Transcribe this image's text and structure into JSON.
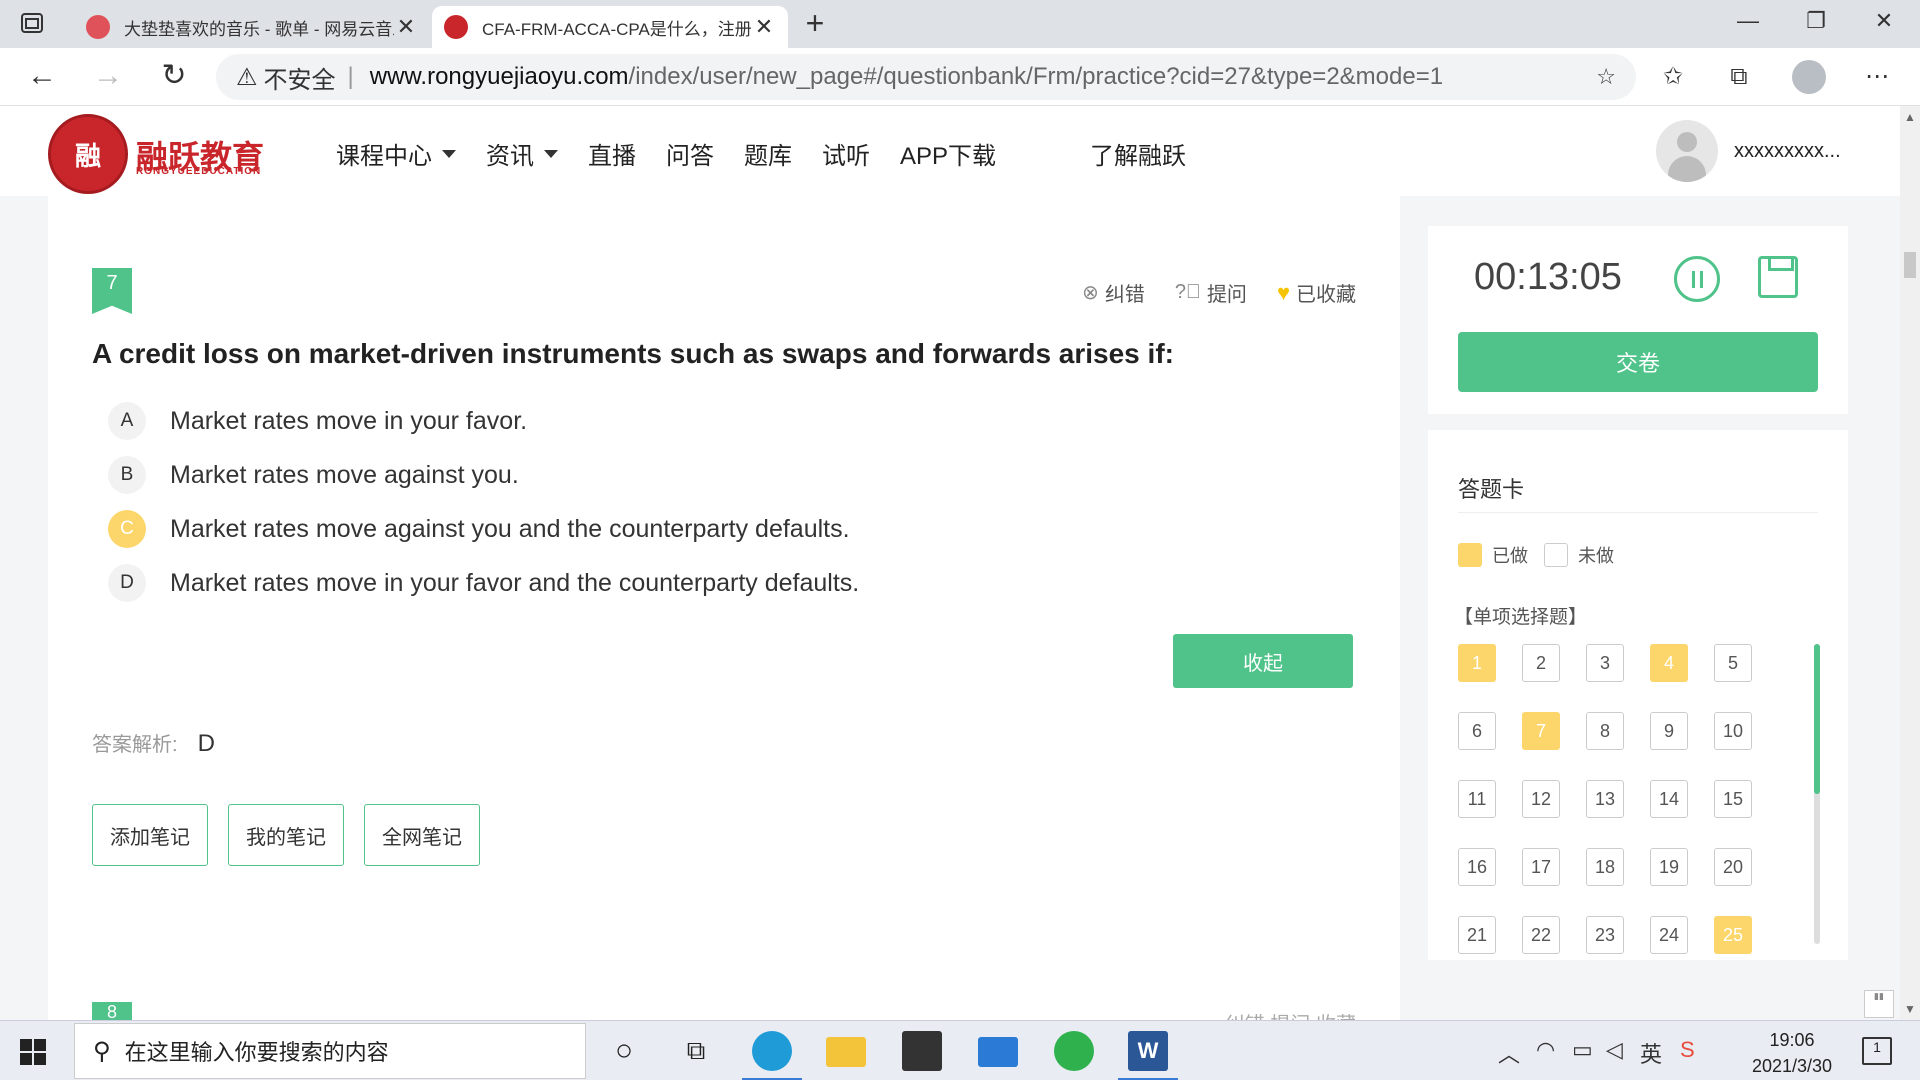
{
  "browser": {
    "tabs": [
      {
        "label": "大垫垫喜欢的音乐 - 歌单 - 网易云音乐",
        "active": false,
        "favicon_color": "#e0525a"
      },
      {
        "label": "CFA-FRM-ACCA-CPA是什么，注册金融分析师",
        "active": true,
        "favicon_color": "#c9262c"
      }
    ],
    "new_tab": "+",
    "window_controls": {
      "minimize": "—",
      "restore": "❐",
      "close": "✕"
    },
    "address": {
      "insecure_label": "不安全",
      "host": "www.rongyuejiaoyu.com",
      "path": "/index/user/new_page#/questionbank/Frm/practice?cid=27&type=2&mode=1"
    },
    "toolbar_icons": [
      "favorites-icon",
      "collections-icon",
      "profile-icon",
      "more-icon"
    ]
  },
  "site": {
    "logo_text": "融跃教育",
    "logo_subtext": "RONGYUEEDUCATION",
    "logo_mark": "融",
    "nav": [
      {
        "label": "课程中心",
        "dropdown": true
      },
      {
        "label": "资讯",
        "dropdown": true
      },
      {
        "label": "直播",
        "dropdown": false
      },
      {
        "label": "问答",
        "dropdown": false
      },
      {
        "label": "题库",
        "dropdown": false
      },
      {
        "label": "试听",
        "dropdown": false
      },
      {
        "label": "APP下载",
        "dropdown": false
      }
    ],
    "about": "了解融跃",
    "user_name": "xxxxxxxxx..."
  },
  "question": {
    "number": "7",
    "actions": {
      "report": "纠错",
      "ask": "提问",
      "favorite": "已收藏"
    },
    "text": "A credit loss on market-driven instruments such as swaps and forwards arises if:",
    "options": [
      {
        "letter": "A",
        "text": "Market rates move in your favor.",
        "selected": false
      },
      {
        "letter": "B",
        "text": "Market rates move against you.",
        "selected": false
      },
      {
        "letter": "C",
        "text": "Market rates move against you and the counterparty defaults.",
        "selected": true
      },
      {
        "letter": "D",
        "text": "Market rates move in your favor and the counterparty defaults.",
        "selected": false
      }
    ],
    "collapse_label": "收起",
    "analysis_label": "答案解析:",
    "answer": "D",
    "note_buttons": {
      "add": "添加笔记",
      "mine": "我的笔记",
      "all": "全网笔记"
    }
  },
  "next_question": {
    "number": "8",
    "actions": "纠错   提问   收藏"
  },
  "panel": {
    "timer": "00:13:05",
    "submit_label": "交卷",
    "card_title": "答题卡",
    "legend": {
      "done": "已做",
      "todo": "未做"
    },
    "section": "【单项选择题】",
    "cells": [
      {
        "n": "1",
        "done": true
      },
      {
        "n": "2",
        "done": false
      },
      {
        "n": "3",
        "done": false
      },
      {
        "n": "4",
        "done": true
      },
      {
        "n": "5",
        "done": false
      },
      {
        "n": "6",
        "done": false
      },
      {
        "n": "7",
        "done": true
      },
      {
        "n": "8",
        "done": false
      },
      {
        "n": "9",
        "done": false
      },
      {
        "n": "10",
        "done": false
      },
      {
        "n": "11",
        "done": false
      },
      {
        "n": "12",
        "done": false
      },
      {
        "n": "13",
        "done": false
      },
      {
        "n": "14",
        "done": false
      },
      {
        "n": "15",
        "done": false
      },
      {
        "n": "16",
        "done": false
      },
      {
        "n": "17",
        "done": false
      },
      {
        "n": "18",
        "done": false
      },
      {
        "n": "19",
        "done": false
      },
      {
        "n": "20",
        "done": false
      },
      {
        "n": "21",
        "done": false
      },
      {
        "n": "22",
        "done": false
      },
      {
        "n": "23",
        "done": false
      },
      {
        "n": "24",
        "done": false
      },
      {
        "n": "25",
        "done": true
      }
    ]
  },
  "taskbar": {
    "search_placeholder": "在这里输入你要搜索的内容",
    "ime": "英",
    "time": "19:06",
    "date": "2021/3/30",
    "notifications": "1"
  },
  "colors": {
    "accent": "#4fc38a",
    "done": "#fcd66a",
    "brand": "#c9262c"
  }
}
